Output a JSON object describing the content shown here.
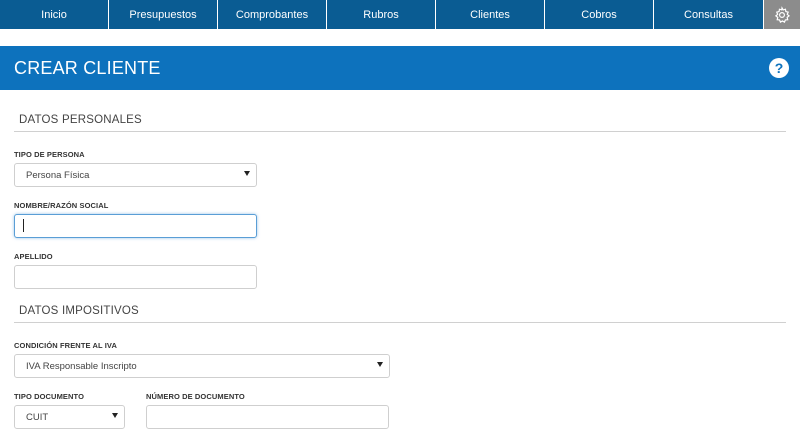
{
  "nav": {
    "items": [
      {
        "label": "Inicio"
      },
      {
        "label": "Presupuestos"
      },
      {
        "label": "Comprobantes"
      },
      {
        "label": "Rubros"
      },
      {
        "label": "Clientes"
      },
      {
        "label": "Cobros"
      },
      {
        "label": "Consultas"
      }
    ],
    "settings_icon": "gear-icon"
  },
  "header": {
    "title": "CREAR CLIENTE",
    "help_label": "?"
  },
  "personal": {
    "section_title": "DATOS PERSONALES",
    "tipo_persona": {
      "label": "TIPO DE PERSONA",
      "value": "Persona Física"
    },
    "nombre": {
      "label": "NOMBRE/RAZÓN SOCIAL",
      "value": ""
    },
    "apellido": {
      "label": "APELLIDO",
      "value": ""
    }
  },
  "impositivos": {
    "section_title": "DATOS IMPOSITIVOS",
    "condicion_iva": {
      "label": "CONDICIÓN FRENTE AL IVA",
      "value": "IVA Responsable Inscripto"
    },
    "tipo_documento": {
      "label": "TIPO DOCUMENTO",
      "value": "CUIT"
    },
    "numero_documento": {
      "label": "NÚMERO DE DOCUMENTO",
      "value": ""
    }
  },
  "colors": {
    "nav_bg": "#0a5c93",
    "header_bg": "#0d72bd",
    "settings_bg": "#8c8c8c",
    "focus_border": "#5a9ed6"
  }
}
